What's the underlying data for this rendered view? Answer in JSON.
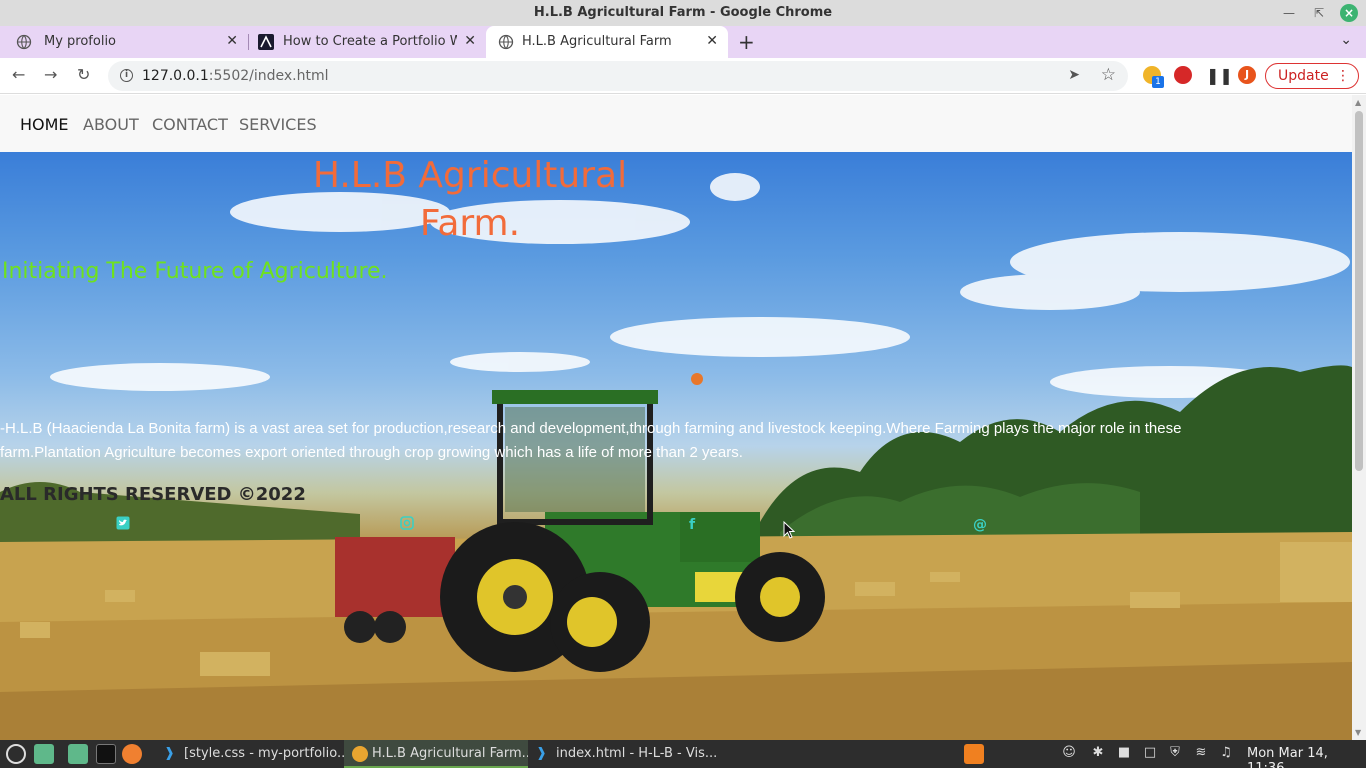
{
  "window": {
    "title": "H.L.B Agricultural Farm - Google Chrome"
  },
  "tabs": [
    {
      "label": "My profolio",
      "icon": "globe-icon"
    },
    {
      "label": "How to Create a Portfolio We",
      "icon": "brand-icon"
    },
    {
      "label": "H.L.B Agricultural Farm",
      "icon": "globe-icon",
      "active": true
    }
  ],
  "toolbar": {
    "url_host": "127.0.0.1",
    "url_rest": ":5502/index.html",
    "update_label": "Update",
    "profile_initial": "J",
    "extension_badge": "1"
  },
  "site": {
    "nav": [
      "HOME",
      "ABOUT",
      "CONTACT",
      "SERVICES"
    ],
    "title_line1": "H.L.B Agricultural",
    "title_line2": "Farm.",
    "tagline": "Initiating The Future of Agriculture.",
    "description": "-H.L.B (Haacienda La Bonita farm) is a vast area set for production,research and development,through farming and livestock keeping.Where Farming plays the major role in these farm.Plantation Agriculture becomes export oriented through crop growing which has a life of more than 2 years.",
    "rights": "ALL RIGHTS RESERVED ©2022",
    "social_icons": [
      "twitter-icon",
      "instagram-icon",
      "facebook-icon",
      "email-icon"
    ],
    "colors": {
      "title": "#f26b3a",
      "tagline": "#6fe21c",
      "social": "#3ad0c4"
    }
  },
  "taskbar": {
    "tasks": [
      {
        "label": "[style.css - my-portfolio..."
      },
      {
        "label": "H.L.B Agricultural Farm...",
        "active": true
      },
      {
        "label": "index.html - H-L-B - Vis..."
      }
    ],
    "clock": "Mon Mar 14, 11:36"
  }
}
